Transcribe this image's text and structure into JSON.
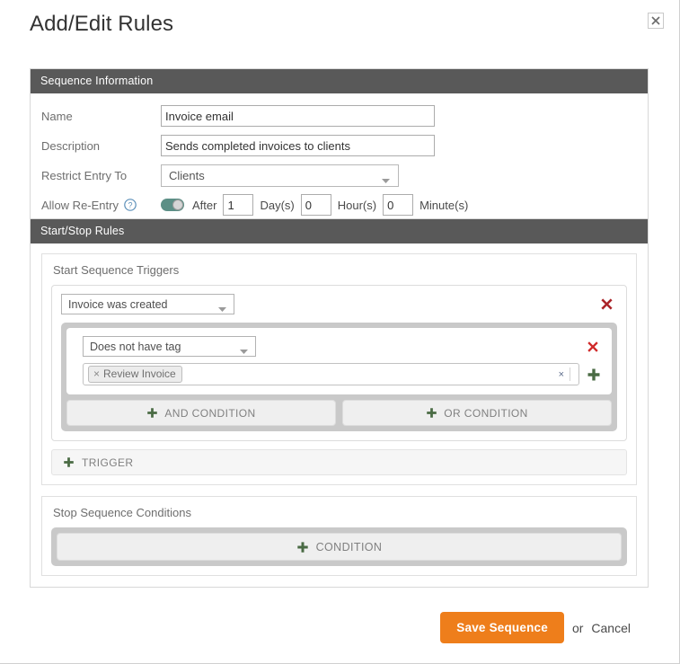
{
  "dialog": {
    "title": "Add/Edit Rules",
    "close_icon": "close-icon"
  },
  "sequence_information": {
    "header": "Sequence Information",
    "fields": {
      "name_label": "Name",
      "name_value": "Invoice email",
      "description_label": "Description",
      "description_value": "Sends completed invoices to clients",
      "restrict_label": "Restrict Entry To",
      "restrict_value": "Clients",
      "reentry_label": "Allow Re-Entry",
      "reentry_help_icon": "help-icon",
      "reentry_toggle_state": "on",
      "after_label": "After",
      "days_value": "1",
      "days_label": "Day(s)",
      "hours_value": "0",
      "hours_label": "Hour(s)",
      "minutes_value": "0",
      "minutes_label": "Minute(s)"
    }
  },
  "start_stop_rules": {
    "header": "Start/Stop Rules",
    "start_triggers": {
      "title": "Start Sequence Triggers",
      "trigger": {
        "select_value": "Invoice was created",
        "delete_icon": "delete-icon",
        "condition": {
          "select_value": "Does not have tag",
          "delete_icon": "delete-icon",
          "tags": [
            {
              "label": "Review Invoice",
              "remove_glyph": "×"
            }
          ],
          "clear_glyph": "×",
          "add_icon": "plus-icon"
        },
        "and_condition_label": "AND CONDITION",
        "or_condition_label": "OR CONDITION"
      },
      "add_trigger_label": "TRIGGER"
    },
    "stop_conditions": {
      "title": "Stop Sequence Conditions",
      "add_condition_label": "CONDITION"
    }
  },
  "footer": {
    "save_label": "Save Sequence",
    "or_label": "or",
    "cancel_label": "Cancel"
  },
  "colors": {
    "panel_header_bg": "#595959",
    "save_button": "#ee7e1b",
    "delete_red": "#ab2328",
    "plus_green": "#4a6b44",
    "toggle_on": "#5c8f86"
  }
}
